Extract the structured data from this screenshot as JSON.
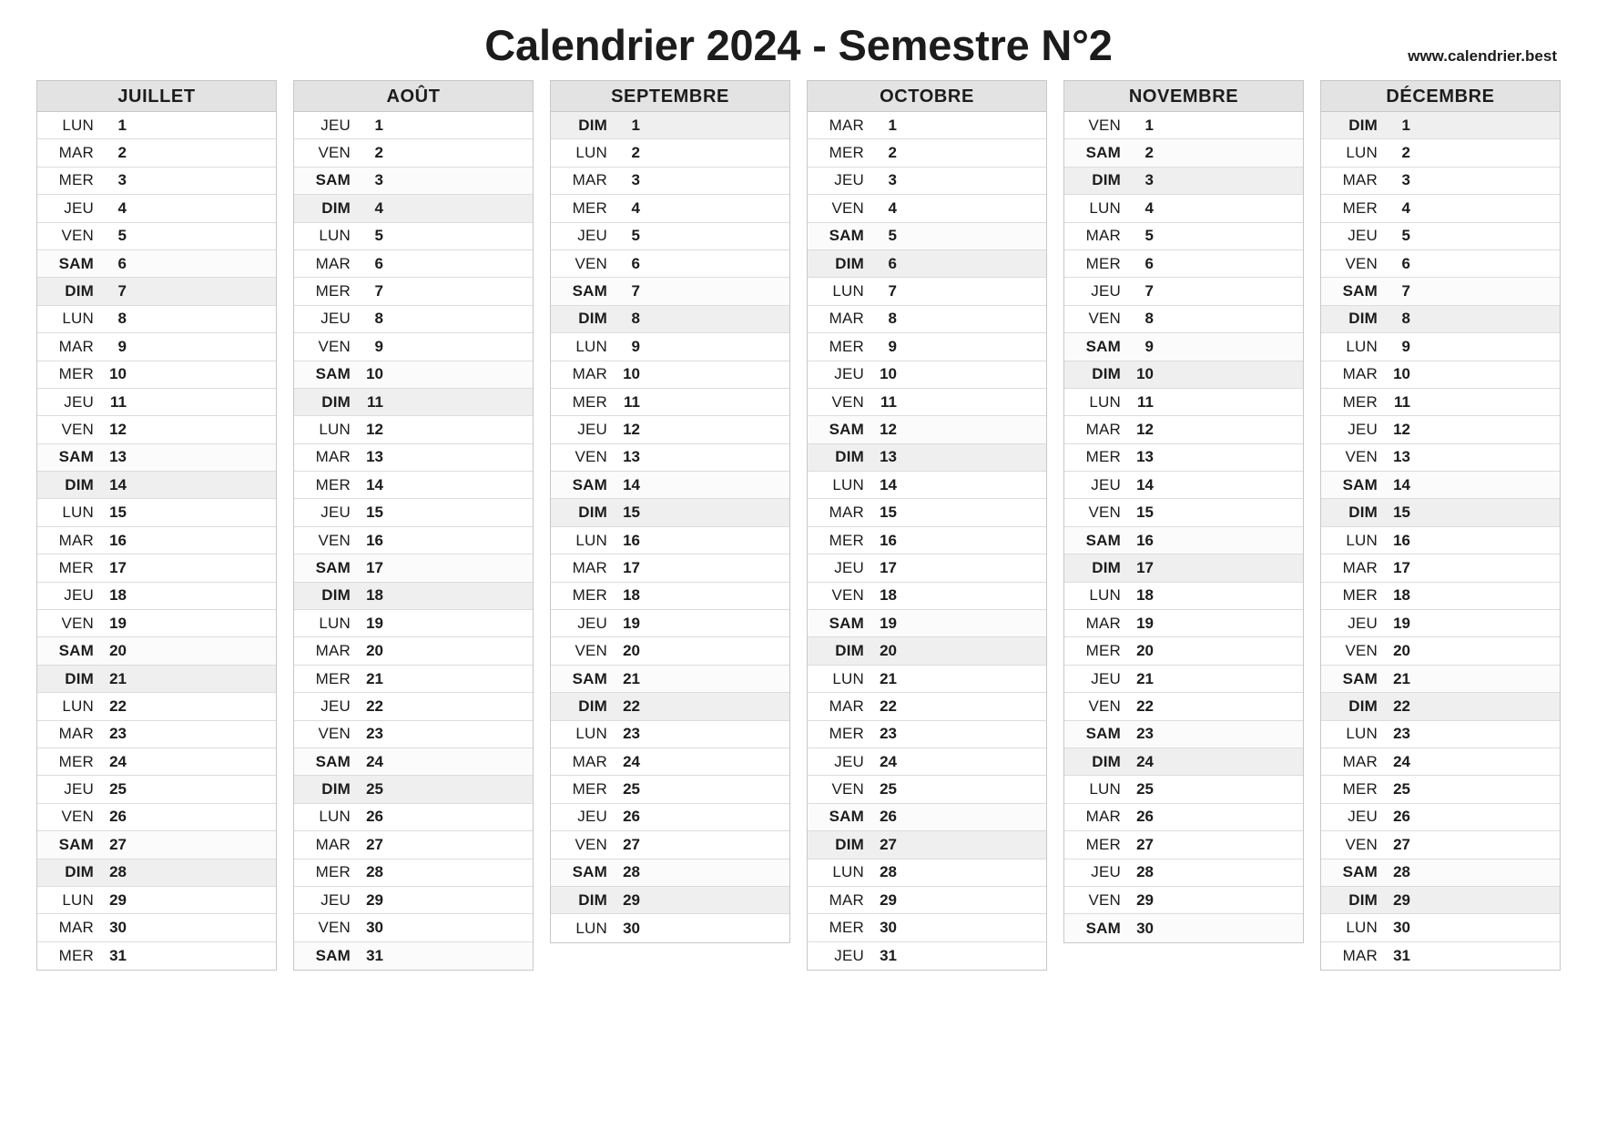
{
  "header": {
    "title": "Calendrier 2024 - Semestre N°2",
    "url": "www.calendrier.best"
  },
  "colors": {
    "header_bg": "#e3e3e3",
    "sunday_bg": "#efefef",
    "saturday_bg": "#fbfbfb",
    "border": "#c8c8c8",
    "row_divider": "#dcdcdc",
    "text": "#1c1c1c"
  },
  "weekend_labels": {
    "saturday": "SAM",
    "sunday": "DIM"
  },
  "months": [
    {
      "name": "JUILLET",
      "days": [
        {
          "dow": "LUN",
          "num": "1"
        },
        {
          "dow": "MAR",
          "num": "2"
        },
        {
          "dow": "MER",
          "num": "3"
        },
        {
          "dow": "JEU",
          "num": "4"
        },
        {
          "dow": "VEN",
          "num": "5"
        },
        {
          "dow": "SAM",
          "num": "6"
        },
        {
          "dow": "DIM",
          "num": "7"
        },
        {
          "dow": "LUN",
          "num": "8"
        },
        {
          "dow": "MAR",
          "num": "9"
        },
        {
          "dow": "MER",
          "num": "10"
        },
        {
          "dow": "JEU",
          "num": "11"
        },
        {
          "dow": "VEN",
          "num": "12"
        },
        {
          "dow": "SAM",
          "num": "13"
        },
        {
          "dow": "DIM",
          "num": "14"
        },
        {
          "dow": "LUN",
          "num": "15"
        },
        {
          "dow": "MAR",
          "num": "16"
        },
        {
          "dow": "MER",
          "num": "17"
        },
        {
          "dow": "JEU",
          "num": "18"
        },
        {
          "dow": "VEN",
          "num": "19"
        },
        {
          "dow": "SAM",
          "num": "20"
        },
        {
          "dow": "DIM",
          "num": "21"
        },
        {
          "dow": "LUN",
          "num": "22"
        },
        {
          "dow": "MAR",
          "num": "23"
        },
        {
          "dow": "MER",
          "num": "24"
        },
        {
          "dow": "JEU",
          "num": "25"
        },
        {
          "dow": "VEN",
          "num": "26"
        },
        {
          "dow": "SAM",
          "num": "27"
        },
        {
          "dow": "DIM",
          "num": "28"
        },
        {
          "dow": "LUN",
          "num": "29"
        },
        {
          "dow": "MAR",
          "num": "30"
        },
        {
          "dow": "MER",
          "num": "31"
        }
      ]
    },
    {
      "name": "AOÛT",
      "days": [
        {
          "dow": "JEU",
          "num": "1"
        },
        {
          "dow": "VEN",
          "num": "2"
        },
        {
          "dow": "SAM",
          "num": "3"
        },
        {
          "dow": "DIM",
          "num": "4"
        },
        {
          "dow": "LUN",
          "num": "5"
        },
        {
          "dow": "MAR",
          "num": "6"
        },
        {
          "dow": "MER",
          "num": "7"
        },
        {
          "dow": "JEU",
          "num": "8"
        },
        {
          "dow": "VEN",
          "num": "9"
        },
        {
          "dow": "SAM",
          "num": "10"
        },
        {
          "dow": "DIM",
          "num": "11"
        },
        {
          "dow": "LUN",
          "num": "12"
        },
        {
          "dow": "MAR",
          "num": "13"
        },
        {
          "dow": "MER",
          "num": "14"
        },
        {
          "dow": "JEU",
          "num": "15"
        },
        {
          "dow": "VEN",
          "num": "16"
        },
        {
          "dow": "SAM",
          "num": "17"
        },
        {
          "dow": "DIM",
          "num": "18"
        },
        {
          "dow": "LUN",
          "num": "19"
        },
        {
          "dow": "MAR",
          "num": "20"
        },
        {
          "dow": "MER",
          "num": "21"
        },
        {
          "dow": "JEU",
          "num": "22"
        },
        {
          "dow": "VEN",
          "num": "23"
        },
        {
          "dow": "SAM",
          "num": "24"
        },
        {
          "dow": "DIM",
          "num": "25"
        },
        {
          "dow": "LUN",
          "num": "26"
        },
        {
          "dow": "MAR",
          "num": "27"
        },
        {
          "dow": "MER",
          "num": "28"
        },
        {
          "dow": "JEU",
          "num": "29"
        },
        {
          "dow": "VEN",
          "num": "30"
        },
        {
          "dow": "SAM",
          "num": "31"
        }
      ]
    },
    {
      "name": "SEPTEMBRE",
      "days": [
        {
          "dow": "DIM",
          "num": "1"
        },
        {
          "dow": "LUN",
          "num": "2"
        },
        {
          "dow": "MAR",
          "num": "3"
        },
        {
          "dow": "MER",
          "num": "4"
        },
        {
          "dow": "JEU",
          "num": "5"
        },
        {
          "dow": "VEN",
          "num": "6"
        },
        {
          "dow": "SAM",
          "num": "7"
        },
        {
          "dow": "DIM",
          "num": "8"
        },
        {
          "dow": "LUN",
          "num": "9"
        },
        {
          "dow": "MAR",
          "num": "10"
        },
        {
          "dow": "MER",
          "num": "11"
        },
        {
          "dow": "JEU",
          "num": "12"
        },
        {
          "dow": "VEN",
          "num": "13"
        },
        {
          "dow": "SAM",
          "num": "14"
        },
        {
          "dow": "DIM",
          "num": "15"
        },
        {
          "dow": "LUN",
          "num": "16"
        },
        {
          "dow": "MAR",
          "num": "17"
        },
        {
          "dow": "MER",
          "num": "18"
        },
        {
          "dow": "JEU",
          "num": "19"
        },
        {
          "dow": "VEN",
          "num": "20"
        },
        {
          "dow": "SAM",
          "num": "21"
        },
        {
          "dow": "DIM",
          "num": "22"
        },
        {
          "dow": "LUN",
          "num": "23"
        },
        {
          "dow": "MAR",
          "num": "24"
        },
        {
          "dow": "MER",
          "num": "25"
        },
        {
          "dow": "JEU",
          "num": "26"
        },
        {
          "dow": "VEN",
          "num": "27"
        },
        {
          "dow": "SAM",
          "num": "28"
        },
        {
          "dow": "DIM",
          "num": "29"
        },
        {
          "dow": "LUN",
          "num": "30"
        }
      ]
    },
    {
      "name": "OCTOBRE",
      "days": [
        {
          "dow": "MAR",
          "num": "1"
        },
        {
          "dow": "MER",
          "num": "2"
        },
        {
          "dow": "JEU",
          "num": "3"
        },
        {
          "dow": "VEN",
          "num": "4"
        },
        {
          "dow": "SAM",
          "num": "5"
        },
        {
          "dow": "DIM",
          "num": "6"
        },
        {
          "dow": "LUN",
          "num": "7"
        },
        {
          "dow": "MAR",
          "num": "8"
        },
        {
          "dow": "MER",
          "num": "9"
        },
        {
          "dow": "JEU",
          "num": "10"
        },
        {
          "dow": "VEN",
          "num": "11"
        },
        {
          "dow": "SAM",
          "num": "12"
        },
        {
          "dow": "DIM",
          "num": "13"
        },
        {
          "dow": "LUN",
          "num": "14"
        },
        {
          "dow": "MAR",
          "num": "15"
        },
        {
          "dow": "MER",
          "num": "16"
        },
        {
          "dow": "JEU",
          "num": "17"
        },
        {
          "dow": "VEN",
          "num": "18"
        },
        {
          "dow": "SAM",
          "num": "19"
        },
        {
          "dow": "DIM",
          "num": "20"
        },
        {
          "dow": "LUN",
          "num": "21"
        },
        {
          "dow": "MAR",
          "num": "22"
        },
        {
          "dow": "MER",
          "num": "23"
        },
        {
          "dow": "JEU",
          "num": "24"
        },
        {
          "dow": "VEN",
          "num": "25"
        },
        {
          "dow": "SAM",
          "num": "26"
        },
        {
          "dow": "DIM",
          "num": "27"
        },
        {
          "dow": "LUN",
          "num": "28"
        },
        {
          "dow": "MAR",
          "num": "29"
        },
        {
          "dow": "MER",
          "num": "30"
        },
        {
          "dow": "JEU",
          "num": "31"
        }
      ]
    },
    {
      "name": "NOVEMBRE",
      "days": [
        {
          "dow": "VEN",
          "num": "1"
        },
        {
          "dow": "SAM",
          "num": "2"
        },
        {
          "dow": "DIM",
          "num": "3"
        },
        {
          "dow": "LUN",
          "num": "4"
        },
        {
          "dow": "MAR",
          "num": "5"
        },
        {
          "dow": "MER",
          "num": "6"
        },
        {
          "dow": "JEU",
          "num": "7"
        },
        {
          "dow": "VEN",
          "num": "8"
        },
        {
          "dow": "SAM",
          "num": "9"
        },
        {
          "dow": "DIM",
          "num": "10"
        },
        {
          "dow": "LUN",
          "num": "11"
        },
        {
          "dow": "MAR",
          "num": "12"
        },
        {
          "dow": "MER",
          "num": "13"
        },
        {
          "dow": "JEU",
          "num": "14"
        },
        {
          "dow": "VEN",
          "num": "15"
        },
        {
          "dow": "SAM",
          "num": "16"
        },
        {
          "dow": "DIM",
          "num": "17"
        },
        {
          "dow": "LUN",
          "num": "18"
        },
        {
          "dow": "MAR",
          "num": "19"
        },
        {
          "dow": "MER",
          "num": "20"
        },
        {
          "dow": "JEU",
          "num": "21"
        },
        {
          "dow": "VEN",
          "num": "22"
        },
        {
          "dow": "SAM",
          "num": "23"
        },
        {
          "dow": "DIM",
          "num": "24"
        },
        {
          "dow": "LUN",
          "num": "25"
        },
        {
          "dow": "MAR",
          "num": "26"
        },
        {
          "dow": "MER",
          "num": "27"
        },
        {
          "dow": "JEU",
          "num": "28"
        },
        {
          "dow": "VEN",
          "num": "29"
        },
        {
          "dow": "SAM",
          "num": "30"
        }
      ]
    },
    {
      "name": "DÉCEMBRE",
      "days": [
        {
          "dow": "DIM",
          "num": "1"
        },
        {
          "dow": "LUN",
          "num": "2"
        },
        {
          "dow": "MAR",
          "num": "3"
        },
        {
          "dow": "MER",
          "num": "4"
        },
        {
          "dow": "JEU",
          "num": "5"
        },
        {
          "dow": "VEN",
          "num": "6"
        },
        {
          "dow": "SAM",
          "num": "7"
        },
        {
          "dow": "DIM",
          "num": "8"
        },
        {
          "dow": "LUN",
          "num": "9"
        },
        {
          "dow": "MAR",
          "num": "10"
        },
        {
          "dow": "MER",
          "num": "11"
        },
        {
          "dow": "JEU",
          "num": "12"
        },
        {
          "dow": "VEN",
          "num": "13"
        },
        {
          "dow": "SAM",
          "num": "14"
        },
        {
          "dow": "DIM",
          "num": "15"
        },
        {
          "dow": "LUN",
          "num": "16"
        },
        {
          "dow": "MAR",
          "num": "17"
        },
        {
          "dow": "MER",
          "num": "18"
        },
        {
          "dow": "JEU",
          "num": "19"
        },
        {
          "dow": "VEN",
          "num": "20"
        },
        {
          "dow": "SAM",
          "num": "21"
        },
        {
          "dow": "DIM",
          "num": "22"
        },
        {
          "dow": "LUN",
          "num": "23"
        },
        {
          "dow": "MAR",
          "num": "24"
        },
        {
          "dow": "MER",
          "num": "25"
        },
        {
          "dow": "JEU",
          "num": "26"
        },
        {
          "dow": "VEN",
          "num": "27"
        },
        {
          "dow": "SAM",
          "num": "28"
        },
        {
          "dow": "DIM",
          "num": "29"
        },
        {
          "dow": "LUN",
          "num": "30"
        },
        {
          "dow": "MAR",
          "num": "31"
        }
      ]
    }
  ]
}
